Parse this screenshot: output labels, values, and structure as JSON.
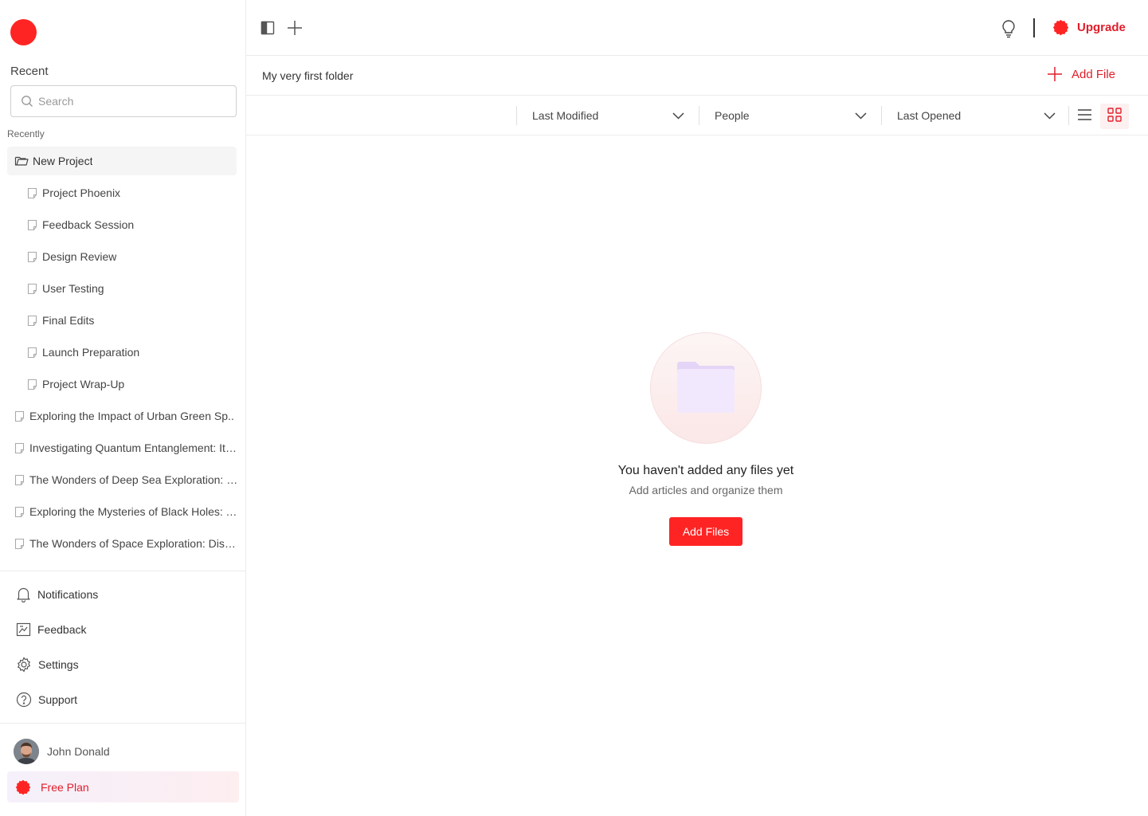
{
  "sidebar": {
    "recent_title": "Recent",
    "search_placeholder": "Search",
    "recently_label": "Recently",
    "folder": {
      "label": "New Project",
      "icon": "folder-open-icon"
    },
    "subitems": [
      "Project Phoenix",
      "Feedback Session",
      "Design Review",
      "User Testing",
      "Final Edits",
      "Launch Preparation",
      "Project Wrap-Up"
    ],
    "items": [
      "Exploring the Impact of Urban Green Sp..",
      "Investigating Quantum Entanglement: Its ..",
      "The Wonders of Deep Sea Exploration: U..",
      "Exploring the Mysteries of Black Holes: Th..",
      "The Wonders of Space Exploration: Discov.."
    ],
    "nav": [
      {
        "label": "Notifications",
        "icon": "bell-icon"
      },
      {
        "label": "Feedback",
        "icon": "feedback-icon"
      },
      {
        "label": "Settings",
        "icon": "gear-icon"
      },
      {
        "label": "Support",
        "icon": "help-circle-icon"
      }
    ],
    "user_name": "John Donald",
    "plan_label": "Free Plan"
  },
  "topbar": {
    "upgrade_label": "Upgrade"
  },
  "folderbar": {
    "title": "My very first folder",
    "add_file_label": "Add File"
  },
  "filters": [
    "Last Modified",
    "People",
    "Last Opened"
  ],
  "empty_state": {
    "title": "You haven't added any files yet",
    "subtitle": "Add articles and organize them",
    "button_label": "Add Files"
  },
  "colors": {
    "accent": "#ff2424",
    "accent_text": "#e11d2a"
  }
}
